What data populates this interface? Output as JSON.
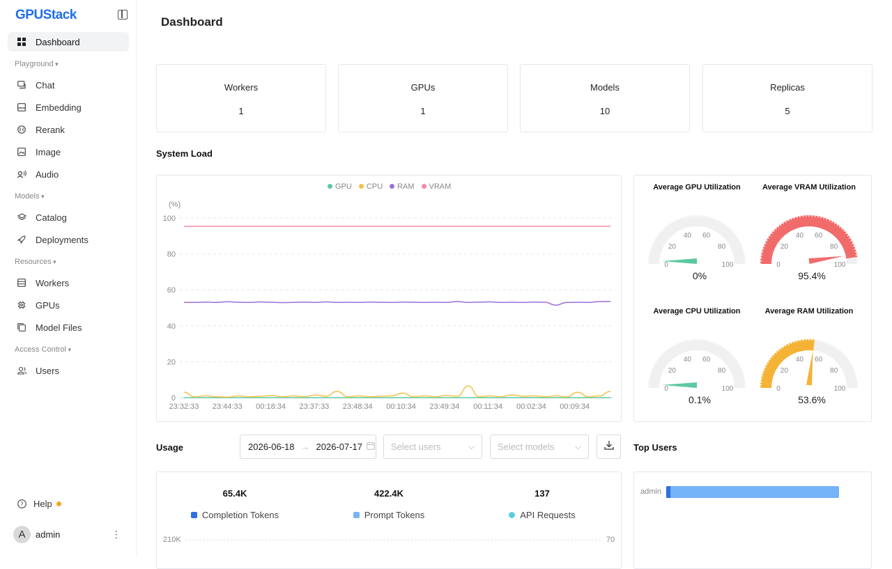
{
  "app": {
    "logo": "GPUStack"
  },
  "sidebar": {
    "items": {
      "dashboard": "Dashboard",
      "playground": "Playground",
      "chat": "Chat",
      "embedding": "Embedding",
      "rerank": "Rerank",
      "image": "Image",
      "audio": "Audio",
      "models": "Models",
      "catalog": "Catalog",
      "deployments": "Deployments",
      "resources": "Resources",
      "workers": "Workers",
      "gpus": "GPUs",
      "model_files": "Model Files",
      "access_control": "Access Control",
      "users": "Users"
    },
    "help": "Help",
    "user": {
      "initial": "A",
      "name": "admin"
    }
  },
  "page": {
    "title": "Dashboard"
  },
  "stats": [
    {
      "label": "Workers",
      "value": "1"
    },
    {
      "label": "GPUs",
      "value": "1"
    },
    {
      "label": "Models",
      "value": "10"
    },
    {
      "label": "Replicas",
      "value": "5"
    }
  ],
  "system_load": {
    "title": "System Load",
    "unit": "(%)",
    "legend": [
      "GPU",
      "CPU",
      "RAM",
      "VRAM"
    ],
    "colors": {
      "GPU": "#5cc8a0",
      "CPU": "#f5c04a",
      "RAM": "#9b6fd6",
      "VRAM": "#f58aa5"
    }
  },
  "gauges": [
    {
      "title": "Average GPU Utilization",
      "value": 0,
      "display": "0",
      "unit": "%",
      "color": "#5cc8a0"
    },
    {
      "title": "Average VRAM Utilization",
      "value": 95.4,
      "display": "95.4",
      "unit": "%",
      "color": "#f26b6b"
    },
    {
      "title": "Average CPU Utilization",
      "value": 0.1,
      "display": "0.1",
      "unit": "%",
      "color": "#5cc8a0"
    },
    {
      "title": "Average RAM Utilization",
      "value": 53.6,
      "display": "53.6",
      "unit": "%",
      "color": "#f5b335"
    }
  ],
  "gauge_ticks": [
    "0",
    "20",
    "40",
    "60",
    "80",
    "100"
  ],
  "usage": {
    "title": "Usage",
    "date_start": "2026-06-18",
    "date_end": "2026-07-17",
    "users_placeholder": "Select users",
    "models_placeholder": "Select models",
    "metrics": [
      {
        "value": "65.4K",
        "name": "Completion Tokens",
        "color": "#2f6fe0"
      },
      {
        "value": "422.4K",
        "name": "Prompt Tokens",
        "color": "#7ab3f5"
      },
      {
        "value": "137",
        "name": "API Requests",
        "color": "#5ccde0"
      }
    ],
    "left_axis_top": "210K",
    "right_axis_top": "70"
  },
  "top_users": {
    "title": "Top Users",
    "users": [
      {
        "name": "admin",
        "value": 1
      }
    ]
  },
  "chart_data": {
    "type": "line",
    "title": "",
    "xlabel": "",
    "ylabel": "(%)",
    "ylim": [
      0,
      100
    ],
    "yticks": [
      0,
      20,
      40,
      60,
      80,
      100
    ],
    "grid": true,
    "legend": "top-center",
    "x": [
      "23:32:33",
      "23:44:33",
      "00:18:34",
      "23:37:33",
      "23:48:34",
      "00:10:34",
      "23:49:34",
      "00:11:34",
      "00:02:34",
      "00:09:34"
    ],
    "series": [
      {
        "name": "GPU",
        "values": [
          0,
          0,
          0,
          0,
          0,
          0,
          0,
          0,
          0,
          0,
          0,
          0,
          0,
          0,
          0,
          0,
          0,
          0,
          0,
          0,
          0,
          0,
          0,
          0,
          0,
          0,
          0,
          0,
          0,
          0,
          0,
          0,
          0,
          0,
          0,
          0,
          0,
          0,
          0,
          0
        ]
      },
      {
        "name": "CPU",
        "values": [
          3,
          0.5,
          1,
          0.5,
          0.3,
          1,
          0.5,
          0.8,
          1.2,
          0.5,
          1,
          0.5,
          1.5,
          0.8,
          3.5,
          0.5,
          1,
          0.5,
          0.8,
          1,
          2.5,
          0.5,
          1,
          0.5,
          1.2,
          0.8,
          6.5,
          0.5,
          1,
          0.5,
          1.5,
          0.8,
          1,
          0.5,
          1,
          0.5,
          3,
          0.5,
          1,
          3.5
        ]
      },
      {
        "name": "RAM",
        "values": [
          53,
          53,
          53.2,
          53,
          53.4,
          53.1,
          53,
          53.3,
          53.1,
          52.9,
          53,
          53.2,
          53,
          53.3,
          53,
          53.1,
          53,
          53.2,
          53.1,
          53,
          53.2,
          53.1,
          53,
          53.1,
          53,
          53.5,
          53,
          53.2,
          53.3,
          53,
          53.1,
          53,
          53.2,
          53.1,
          51.5,
          53,
          53.1,
          53,
          53.5,
          53.6
        ]
      },
      {
        "name": "VRAM",
        "values": [
          95.4,
          95.4,
          95.4,
          95.4,
          95.4,
          95.4,
          95.4,
          95.4,
          95.4,
          95.4,
          95.4,
          95.4,
          95.4,
          95.4,
          95.4,
          95.4,
          95.4,
          95.4,
          95.4,
          95.4,
          95.4,
          95.4,
          95.4,
          95.4,
          95.4,
          95.4,
          95.4,
          95.4,
          95.4,
          95.4,
          95.4,
          95.4,
          95.4,
          95.4,
          95.4,
          95.4,
          95.4,
          95.4,
          95.4,
          95.4
        ]
      }
    ]
  }
}
